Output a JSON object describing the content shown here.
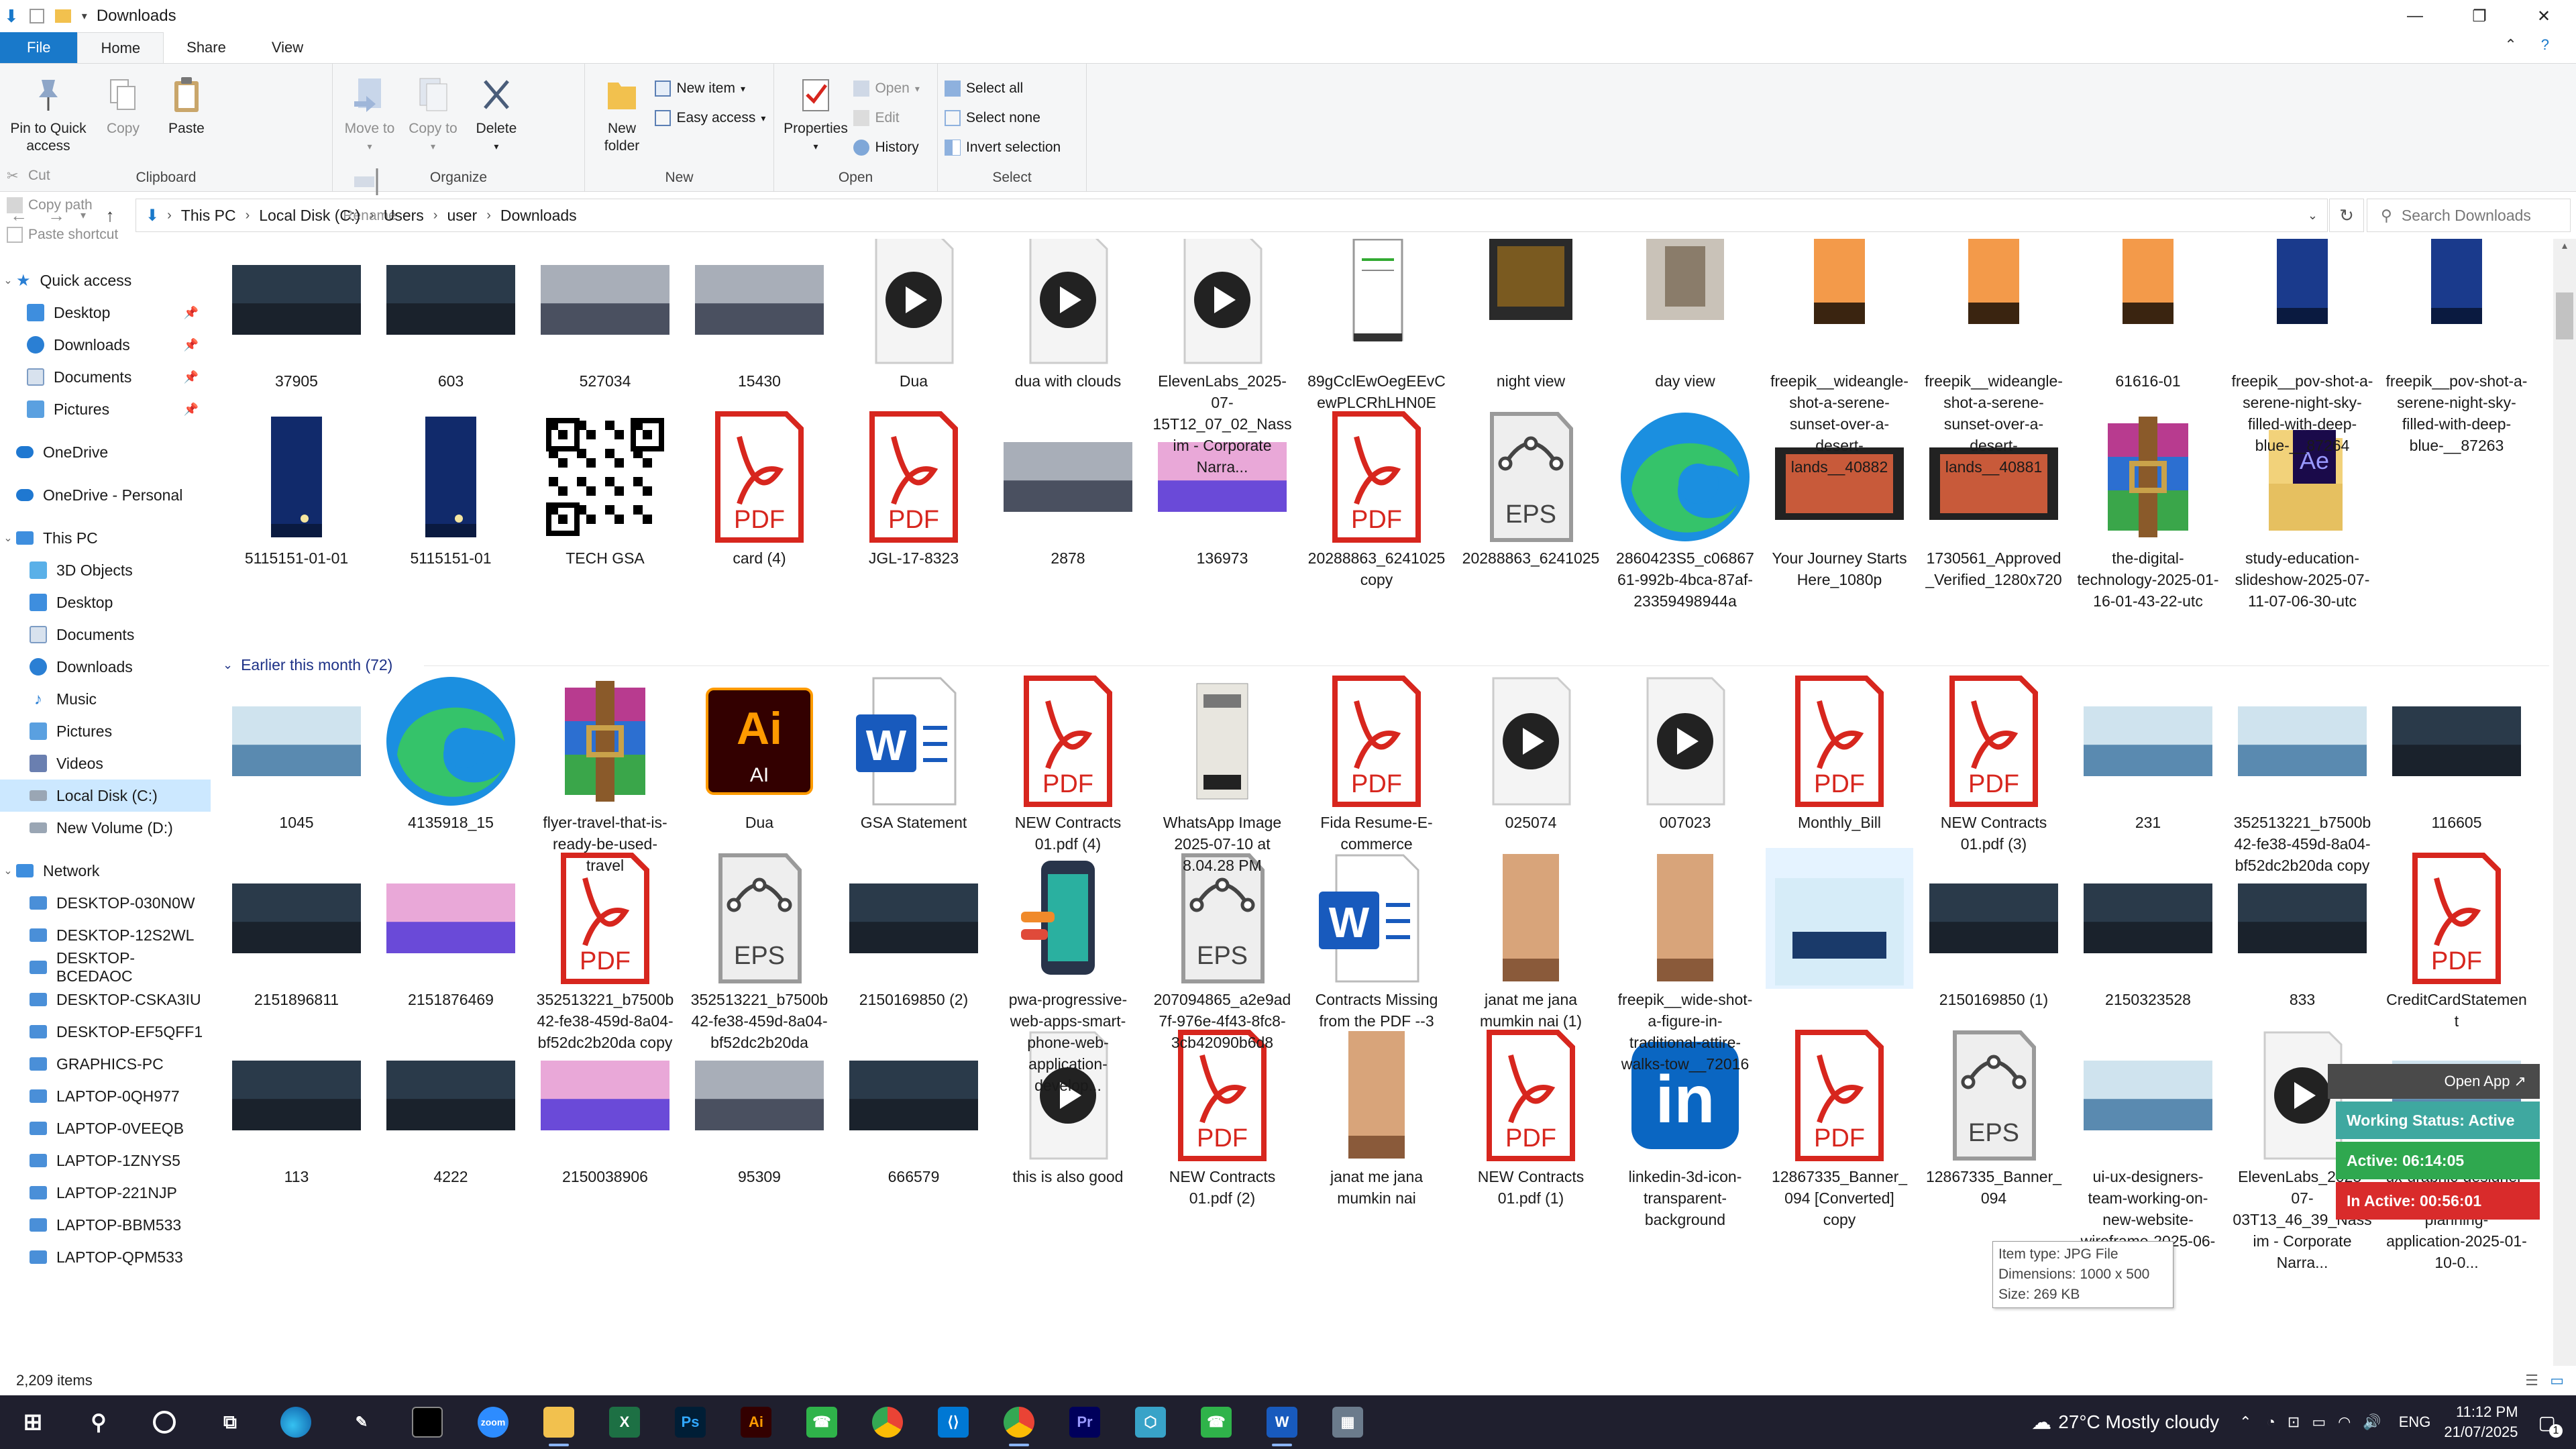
{
  "window": {
    "title": "Downloads"
  },
  "tabs": {
    "file": "File",
    "home": "Home",
    "share": "Share",
    "view": "View"
  },
  "ribbon": {
    "clipboard": {
      "label": "Clipboard",
      "pin": "Pin to Quick access",
      "copy": "Copy",
      "paste": "Paste",
      "cut": "Cut",
      "copy_path": "Copy path",
      "paste_shortcut": "Paste shortcut"
    },
    "organize": {
      "label": "Organize",
      "move_to": "Move to",
      "copy_to": "Copy to",
      "delete": "Delete",
      "rename": "Rename"
    },
    "new": {
      "label": "New",
      "new_folder": "New folder",
      "new_item": "New item",
      "easy_access": "Easy access"
    },
    "open": {
      "label": "Open",
      "properties": "Properties",
      "open": "Open",
      "edit": "Edit",
      "history": "History"
    },
    "select": {
      "label": "Select",
      "select_all": "Select all",
      "select_none": "Select none",
      "invert": "Invert selection"
    }
  },
  "address": {
    "crumbs": [
      "This PC",
      "Local Disk (C:)",
      "Users",
      "user",
      "Downloads"
    ],
    "search_placeholder": "Search Downloads"
  },
  "nav": {
    "quick_access": "Quick access",
    "quick_items": [
      "Desktop",
      "Downloads",
      "Documents",
      "Pictures"
    ],
    "onedrive": "OneDrive",
    "onedrive_personal": "OneDrive - Personal",
    "this_pc": "This PC",
    "pc_items": [
      "3D Objects",
      "Desktop",
      "Documents",
      "Downloads",
      "Music",
      "Pictures",
      "Videos",
      "Local Disk (C:)",
      "New Volume (D:)"
    ],
    "network": "Network",
    "network_items": [
      "DESKTOP-030N0W",
      "DESKTOP-12S2WL",
      "DESKTOP-BCEDAOC",
      "DESKTOP-CSKA3IU",
      "DESKTOP-EF5QFF1",
      "GRAPHICS-PC",
      "LAPTOP-0QH977",
      "LAPTOP-0VEEQB",
      "LAPTOP-1ZNYS5",
      "LAPTOP-221NJP",
      "LAPTOP-BBM533",
      "LAPTOP-QPM533"
    ]
  },
  "group_header": "Earlier this month (72)",
  "rows": [
    [
      "37905",
      "603",
      "527034",
      "15430",
      "Dua",
      "dua with clouds",
      "ElevenLabs_2025-07-15T12_07_02_Nassim - Corporate Narra...",
      "89gCclEwOegEEvCewPLCRhLHN0E",
      "night view",
      "day view",
      "freepik__wideangle-shot-a-serene-sunset-over-a-desert-lands__40882",
      "freepik__wideangle-shot-a-serene-sunset-over-a-desert-lands__40881",
      "61616-01",
      "freepik__pov-shot-a-serene-night-sky-filled-with-deep-blue-__87264",
      "freepik__pov-shot-a-serene-night-sky-filled-with-deep-blue-__87263"
    ],
    [
      "5115151-01-01",
      "5115151-01",
      "TECH GSA",
      "card (4)",
      "JGL-17-8323",
      "2878",
      "136973",
      "20288863_6241025 copy",
      "20288863_6241025",
      "2860423S5_c0686761-992b-4bca-87af-23359498944a",
      "Your Journey Starts Here_1080p",
      "1730561_Approved_Verified_1280x720",
      "the-digital-technology-2025-01-16-01-43-22-utc",
      "study-education-slideshow-2025-07-11-07-06-30-utc"
    ],
    [
      "1045",
      "4135918_15",
      "flyer-travel-that-is-ready-be-used-travel",
      "Dua",
      "GSA Statement",
      "NEW Contracts 01.pdf (4)",
      "WhatsApp Image 2025-07-10 at 8.04.28 PM",
      "Fida Resume-E-commerce",
      "025074",
      "007023",
      "Monthly_Bill",
      "NEW Contracts 01.pdf (3)",
      "231",
      "352513221_b7500b42-fe38-459d-8a04-bf52dc2b20da copy",
      "116605"
    ],
    [
      "2151896811",
      "2151876469",
      "352513221_b7500b42-fe38-459d-8a04-bf52dc2b20da copy",
      "352513221_b7500b42-fe38-459d-8a04-bf52dc2b20da",
      "2150169850 (2)",
      "pwa-progressive-web-apps-smart-phone-web-application-develop...",
      "207094865_a2e9ad7f-976e-4f43-8fc8-3cb42090b6d8",
      "Contracts Missing from the PDF --3",
      "janat me jana mumkin nai (1)",
      "freepik__wide-shot-a-figure-in-traditional-attire-walks-tow__72016",
      "",
      "2150169850 (1)",
      "2150323528",
      "833",
      "CreditCardStatement"
    ],
    [
      "113",
      "4222",
      "2150038906",
      "95309",
      "666579",
      "this is also good",
      "NEW Contracts 01.pdf (2)",
      "janat me jana mumkin nai",
      "NEW Contracts 01.pdf (1)",
      "linkedin-3d-icon-transparent-background",
      "12867335_Banner_094 [Converted] copy",
      "12867335_Banner_094",
      "ui-ux-designers-team-working-on-new-website-wireframe-2025-06-01-0...",
      "ElevenLabs_2025-07-03T13_46_39_Nassim - Corporate Narra...",
      "ux-graphic-designer-creative-sketch-planning-application-2025-01-10-0..."
    ]
  ],
  "tooltip": {
    "type": "Item type: JPG File",
    "dims": "Dimensions: 1000 x 500",
    "size": "Size: 269 KB"
  },
  "status": {
    "items": "2,209 items"
  },
  "overlay": {
    "open_app": "Open App ↗",
    "working": "Working Status: Active",
    "active": "Active: 06:14:05",
    "inactive": "In Active: 00:56:01"
  },
  "taskbar": {
    "weather": "27°C  Mostly cloudy",
    "lang": "ENG",
    "time": "11:12 PM",
    "date": "21/07/2025",
    "badge": "1"
  },
  "colors": {
    "file_tab": "#1979ca",
    "selected": "#cce8ff",
    "pdf": "#d7261e",
    "group": "#1e3287",
    "working": "#3fa8a0",
    "active": "#2fa84f",
    "inactive": "#d92b2b"
  }
}
